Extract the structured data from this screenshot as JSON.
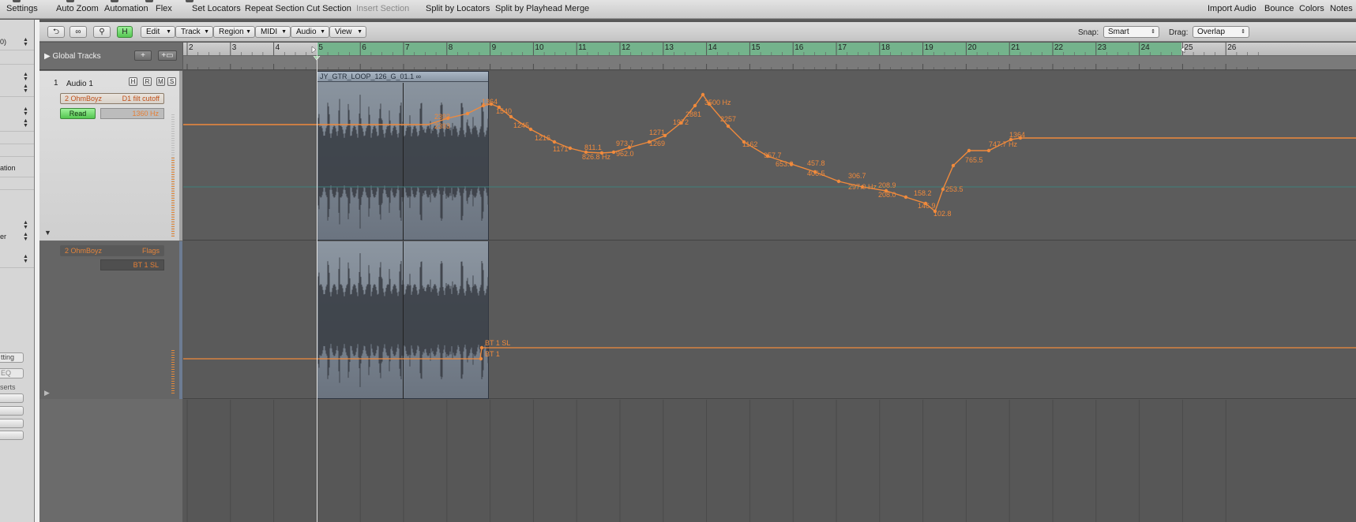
{
  "toolbar": {
    "items": [
      {
        "label": "Settings",
        "enabled": true
      },
      {
        "label": "Auto Zoom",
        "enabled": true
      },
      {
        "label": "Automation",
        "enabled": true
      },
      {
        "label": "Flex",
        "enabled": true
      },
      {
        "label": "Set Locators",
        "enabled": true
      },
      {
        "label": "Repeat Section",
        "enabled": true
      },
      {
        "label": "Cut Section",
        "enabled": true
      },
      {
        "label": "Insert Section",
        "enabled": false
      },
      {
        "label": "Split by Locators",
        "enabled": true
      },
      {
        "label": "Split by Playhead",
        "enabled": true
      },
      {
        "label": "Merge",
        "enabled": true
      },
      {
        "label": "Import Audio",
        "enabled": true
      },
      {
        "label": "Bounce",
        "enabled": true
      },
      {
        "label": "Colors",
        "enabled": true
      },
      {
        "label": "Notes",
        "enabled": true
      }
    ]
  },
  "inspector": {
    "partial_labels": [
      "0)",
      "ation",
      "er"
    ],
    "setting_label": "tting",
    "eq_label": "EQ",
    "inserts_label": "serts"
  },
  "local_bar": {
    "hide_label": "H",
    "menus": [
      "Edit",
      "Track",
      "Region",
      "MIDI",
      "Audio",
      "View"
    ],
    "snap_label": "Snap:",
    "snap_value": "Smart",
    "drag_label": "Drag:",
    "drag_value": "Overlap"
  },
  "global_tracks": {
    "label": "Global Tracks",
    "add_label": "+",
    "add_view_label": "+▭"
  },
  "ruler": {
    "bars": [
      "2",
      "3",
      "4",
      "5",
      "6",
      "7",
      "8",
      "9",
      "10",
      "11",
      "12",
      "13",
      "14",
      "15",
      "16",
      "17",
      "18",
      "19",
      "20",
      "21",
      "22",
      "23",
      "24",
      "25",
      "26"
    ]
  },
  "track1": {
    "number": "1",
    "name": "Audio 1",
    "buttons": [
      "H",
      "R",
      "M",
      "S"
    ],
    "automation_plugin": "2 OhmBoyz",
    "automation_param": "D1 filt cutoff",
    "mode": "Read",
    "current_value": "1360 Hz",
    "region_name": "JY_GTR_LOOP_126_G_01.1",
    "automation_labels": [
      "2393",
      "2393",
      "1364",
      "1540",
      "1245",
      "1216",
      "1171",
      "811.1",
      "826.8 Hz",
      "973.7",
      "962.0",
      "1271",
      "1269",
      "1972",
      "2881",
      "3500 Hz",
      "2257",
      "1162",
      "957.7",
      "653.0",
      "457.8",
      "406.5",
      "306.7",
      "297.0 Hz",
      "208.9",
      "208.0",
      "158.2",
      "146.9",
      "102.8",
      "253.5",
      "765.5",
      "747.7 Hz",
      "1364"
    ]
  },
  "track2": {
    "automation_plugin": "2 OhmBoyz",
    "automation_param": "Flags",
    "current_value": "BT 1 SL",
    "automation_labels": [
      "BT 1 SL",
      "BT 1"
    ]
  },
  "colors": {
    "automation": "#f08a3c",
    "cycle": "#74b38c",
    "read_green": "#6cd668",
    "region": "#8a96a4"
  }
}
